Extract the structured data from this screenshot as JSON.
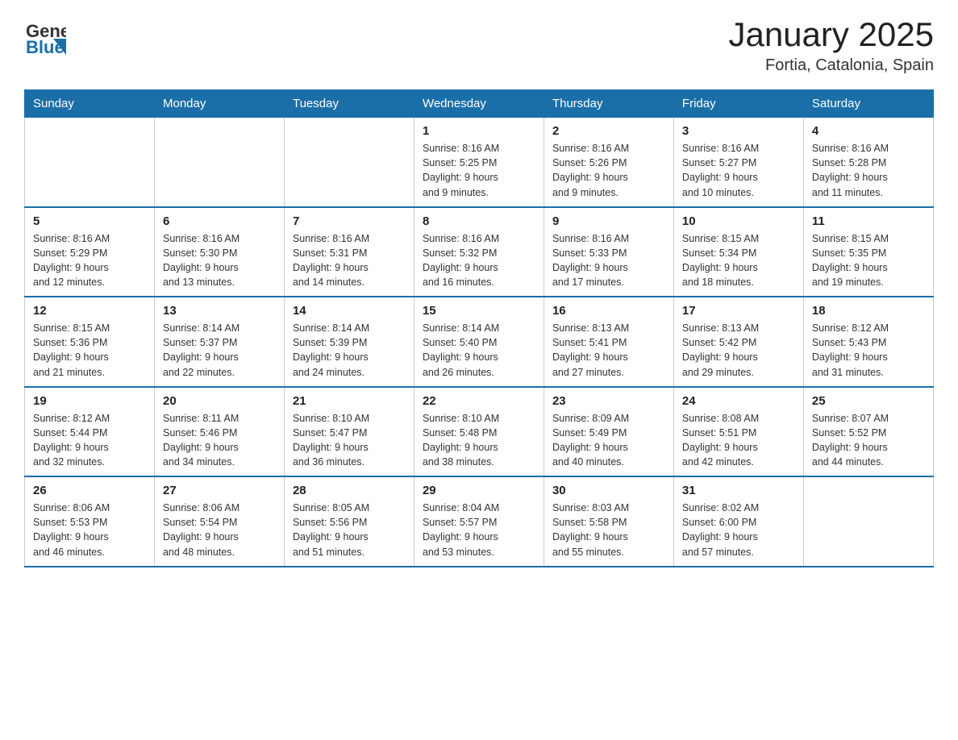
{
  "header": {
    "logo": {
      "general": "General",
      "blue": "Blue"
    },
    "title": "January 2025",
    "subtitle": "Fortia, Catalonia, Spain"
  },
  "weekdays": [
    "Sunday",
    "Monday",
    "Tuesday",
    "Wednesday",
    "Thursday",
    "Friday",
    "Saturday"
  ],
  "weeks": [
    [
      {
        "day": "",
        "info": ""
      },
      {
        "day": "",
        "info": ""
      },
      {
        "day": "",
        "info": ""
      },
      {
        "day": "1",
        "info": "Sunrise: 8:16 AM\nSunset: 5:25 PM\nDaylight: 9 hours\nand 9 minutes."
      },
      {
        "day": "2",
        "info": "Sunrise: 8:16 AM\nSunset: 5:26 PM\nDaylight: 9 hours\nand 9 minutes."
      },
      {
        "day": "3",
        "info": "Sunrise: 8:16 AM\nSunset: 5:27 PM\nDaylight: 9 hours\nand 10 minutes."
      },
      {
        "day": "4",
        "info": "Sunrise: 8:16 AM\nSunset: 5:28 PM\nDaylight: 9 hours\nand 11 minutes."
      }
    ],
    [
      {
        "day": "5",
        "info": "Sunrise: 8:16 AM\nSunset: 5:29 PM\nDaylight: 9 hours\nand 12 minutes."
      },
      {
        "day": "6",
        "info": "Sunrise: 8:16 AM\nSunset: 5:30 PM\nDaylight: 9 hours\nand 13 minutes."
      },
      {
        "day": "7",
        "info": "Sunrise: 8:16 AM\nSunset: 5:31 PM\nDaylight: 9 hours\nand 14 minutes."
      },
      {
        "day": "8",
        "info": "Sunrise: 8:16 AM\nSunset: 5:32 PM\nDaylight: 9 hours\nand 16 minutes."
      },
      {
        "day": "9",
        "info": "Sunrise: 8:16 AM\nSunset: 5:33 PM\nDaylight: 9 hours\nand 17 minutes."
      },
      {
        "day": "10",
        "info": "Sunrise: 8:15 AM\nSunset: 5:34 PM\nDaylight: 9 hours\nand 18 minutes."
      },
      {
        "day": "11",
        "info": "Sunrise: 8:15 AM\nSunset: 5:35 PM\nDaylight: 9 hours\nand 19 minutes."
      }
    ],
    [
      {
        "day": "12",
        "info": "Sunrise: 8:15 AM\nSunset: 5:36 PM\nDaylight: 9 hours\nand 21 minutes."
      },
      {
        "day": "13",
        "info": "Sunrise: 8:14 AM\nSunset: 5:37 PM\nDaylight: 9 hours\nand 22 minutes."
      },
      {
        "day": "14",
        "info": "Sunrise: 8:14 AM\nSunset: 5:39 PM\nDaylight: 9 hours\nand 24 minutes."
      },
      {
        "day": "15",
        "info": "Sunrise: 8:14 AM\nSunset: 5:40 PM\nDaylight: 9 hours\nand 26 minutes."
      },
      {
        "day": "16",
        "info": "Sunrise: 8:13 AM\nSunset: 5:41 PM\nDaylight: 9 hours\nand 27 minutes."
      },
      {
        "day": "17",
        "info": "Sunrise: 8:13 AM\nSunset: 5:42 PM\nDaylight: 9 hours\nand 29 minutes."
      },
      {
        "day": "18",
        "info": "Sunrise: 8:12 AM\nSunset: 5:43 PM\nDaylight: 9 hours\nand 31 minutes."
      }
    ],
    [
      {
        "day": "19",
        "info": "Sunrise: 8:12 AM\nSunset: 5:44 PM\nDaylight: 9 hours\nand 32 minutes."
      },
      {
        "day": "20",
        "info": "Sunrise: 8:11 AM\nSunset: 5:46 PM\nDaylight: 9 hours\nand 34 minutes."
      },
      {
        "day": "21",
        "info": "Sunrise: 8:10 AM\nSunset: 5:47 PM\nDaylight: 9 hours\nand 36 minutes."
      },
      {
        "day": "22",
        "info": "Sunrise: 8:10 AM\nSunset: 5:48 PM\nDaylight: 9 hours\nand 38 minutes."
      },
      {
        "day": "23",
        "info": "Sunrise: 8:09 AM\nSunset: 5:49 PM\nDaylight: 9 hours\nand 40 minutes."
      },
      {
        "day": "24",
        "info": "Sunrise: 8:08 AM\nSunset: 5:51 PM\nDaylight: 9 hours\nand 42 minutes."
      },
      {
        "day": "25",
        "info": "Sunrise: 8:07 AM\nSunset: 5:52 PM\nDaylight: 9 hours\nand 44 minutes."
      }
    ],
    [
      {
        "day": "26",
        "info": "Sunrise: 8:06 AM\nSunset: 5:53 PM\nDaylight: 9 hours\nand 46 minutes."
      },
      {
        "day": "27",
        "info": "Sunrise: 8:06 AM\nSunset: 5:54 PM\nDaylight: 9 hours\nand 48 minutes."
      },
      {
        "day": "28",
        "info": "Sunrise: 8:05 AM\nSunset: 5:56 PM\nDaylight: 9 hours\nand 51 minutes."
      },
      {
        "day": "29",
        "info": "Sunrise: 8:04 AM\nSunset: 5:57 PM\nDaylight: 9 hours\nand 53 minutes."
      },
      {
        "day": "30",
        "info": "Sunrise: 8:03 AM\nSunset: 5:58 PM\nDaylight: 9 hours\nand 55 minutes."
      },
      {
        "day": "31",
        "info": "Sunrise: 8:02 AM\nSunset: 6:00 PM\nDaylight: 9 hours\nand 57 minutes."
      },
      {
        "day": "",
        "info": ""
      }
    ]
  ],
  "colors": {
    "header_bg": "#1a6fa8",
    "header_text": "#ffffff",
    "border": "#cccccc",
    "row_border": "#1a6fa8"
  }
}
